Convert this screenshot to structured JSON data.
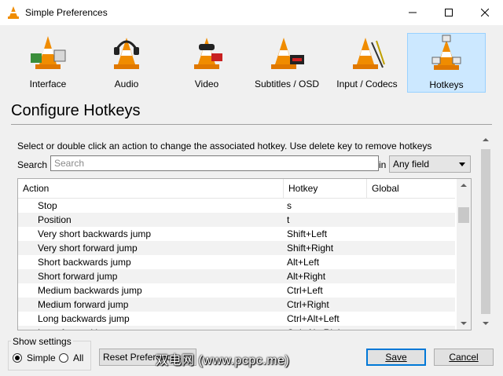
{
  "window": {
    "title": "Simple Preferences"
  },
  "categories": [
    {
      "label": "Interface",
      "icon": "interface-cone-icon"
    },
    {
      "label": "Audio",
      "icon": "audio-cone-icon"
    },
    {
      "label": "Video",
      "icon": "video-cone-icon"
    },
    {
      "label": "Subtitles / OSD",
      "icon": "subtitles-cone-icon"
    },
    {
      "label": "Input / Codecs",
      "icon": "input-codecs-cone-icon"
    },
    {
      "label": "Hotkeys",
      "icon": "hotkeys-cone-icon",
      "selected": true
    }
  ],
  "page": {
    "heading": "Configure Hotkeys"
  },
  "hotkeys": {
    "instructions": "Select or double click an action to change the associated hotkey. Use delete key to remove hotkeys",
    "search_label": "Search",
    "search_placeholder": "Search",
    "search_value": "",
    "in_label": "in",
    "filter_selected": "Any field",
    "columns": [
      "Action",
      "Hotkey",
      "Global"
    ],
    "rows": [
      {
        "action": "Stop",
        "hotkey": "s",
        "global": ""
      },
      {
        "action": "Position",
        "hotkey": "t",
        "global": ""
      },
      {
        "action": "Very short backwards jump",
        "hotkey": "Shift+Left",
        "global": ""
      },
      {
        "action": "Very short forward jump",
        "hotkey": "Shift+Right",
        "global": ""
      },
      {
        "action": "Short backwards jump",
        "hotkey": "Alt+Left",
        "global": ""
      },
      {
        "action": "Short forward jump",
        "hotkey": "Alt+Right",
        "global": ""
      },
      {
        "action": "Medium backwards jump",
        "hotkey": "Ctrl+Left",
        "global": ""
      },
      {
        "action": "Medium forward jump",
        "hotkey": "Ctrl+Right",
        "global": ""
      },
      {
        "action": "Long backwards jump",
        "hotkey": "Ctrl+Alt+Left",
        "global": ""
      },
      {
        "action": "Long forward jump",
        "hotkey": "Ctrl+Alt+Right",
        "global": ""
      }
    ]
  },
  "footer": {
    "show_settings_label": "Show settings",
    "simple_label": "Simple",
    "all_label": "All",
    "selected_mode": "Simple",
    "reset_label": "Reset Preferences",
    "save_label": "Save",
    "cancel_label": "Cancel",
    "watermark": "双电网 (www.pcpc.me)"
  },
  "colors": {
    "accent": "#0078d7",
    "selected_bg": "#cce8ff",
    "cone_orange": "#f08c00"
  }
}
